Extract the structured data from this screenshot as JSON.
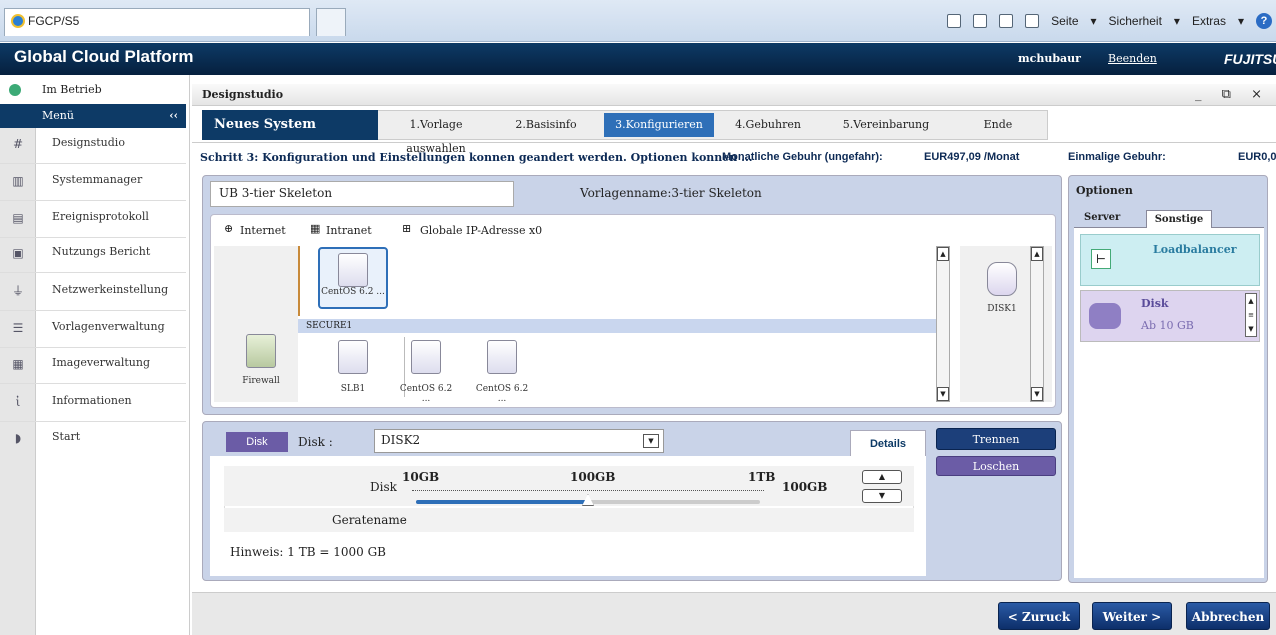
{
  "browser": {
    "tab_title": "FGCP/S5",
    "toolbar": [
      "Seite",
      "Sicherheit",
      "Extras"
    ]
  },
  "app": {
    "title": "Global Cloud Platform",
    "user": "mchubaur",
    "logout": "Beenden",
    "logo": "FUJITSU"
  },
  "sidebar": {
    "status": "Im Betrieb",
    "menu_label": "Menü",
    "collapse": "‹‹",
    "items": [
      {
        "label": "Designstudio",
        "icon": "#"
      },
      {
        "label": "Systemmanager",
        "icon": "▥"
      },
      {
        "label": "Ereignisprotokoll",
        "icon": "▤"
      },
      {
        "label": "Nutzungs Bericht",
        "icon": "▣"
      },
      {
        "label": "Netzwerkeinstellung",
        "icon": "⏚"
      },
      {
        "label": "Vorlagenverwaltung",
        "icon": "☰"
      },
      {
        "label": "Imageverwaltung",
        "icon": "▦"
      },
      {
        "label": "Informationen",
        "icon": "ἰ"
      },
      {
        "label": "Start",
        "icon": "◗"
      }
    ]
  },
  "main": {
    "panel_title": "Designstudio",
    "window_controls": "_ ⧉ ×",
    "wizard_title": "Neues System erstellen",
    "steps": [
      "1.Vorlage auswahlen",
      "2.Basisinfo",
      "3.Konfigurieren",
      "4.Gebuhren",
      "5.Vereinbarung",
      "Ende"
    ],
    "active_step": 2,
    "hint": "Schritt 3: Konfiguration und Einstellungen konnen geandert werden. Optionen konnen ...",
    "monthly_label": "Monatliche Gebuhr (ungefahr):",
    "monthly_value": "EUR497,09 /Monat",
    "onetime_label": "Einmalige Gebuhr:",
    "onetime_value": "EUR0,00"
  },
  "config": {
    "system_name": "UB 3-tier Skeleton",
    "template_name": "Vorlagenname:3-tier Skeleton",
    "net_internet": "Internet",
    "net_intranet": "Intranet",
    "net_global_ip": "Globale IP-Adresse x0",
    "secure_label": "SECURE1",
    "nodes": {
      "centos_top": "CentOS 6.2 ...",
      "firewall": "Firewall",
      "slb": "SLB1",
      "centos_1": "CentOS 6.2 ...",
      "centos_2": "CentOS 6.2 ..."
    },
    "disk1": "DISK1"
  },
  "options": {
    "title": "Optionen",
    "tab_server": "Server",
    "tab_sonstige": "Sonstige",
    "loadbalancer": "Loadbalancer",
    "disk_title": "Disk",
    "disk_sub": "Ab 10 GB"
  },
  "disk": {
    "tag": "Disk",
    "label": "Disk :",
    "selected": "DISK2",
    "details_tab": "Details",
    "row_disk": "Disk",
    "tick_10gb": "10GB",
    "tick_100gb": "100GB",
    "tick_1tb": "1TB",
    "value": "100GB",
    "row_geratename": "Geratename",
    "geratename_value": "-",
    "hint": "Hinweis: 1 TB = 1000 GB",
    "slider_fraction": 0.5,
    "btn_trennen": "Trennen",
    "btn_loschen": "Loschen"
  },
  "footer": {
    "back": "< Zuruck",
    "next": "Weiter >",
    "cancel": "Abbrechen"
  }
}
